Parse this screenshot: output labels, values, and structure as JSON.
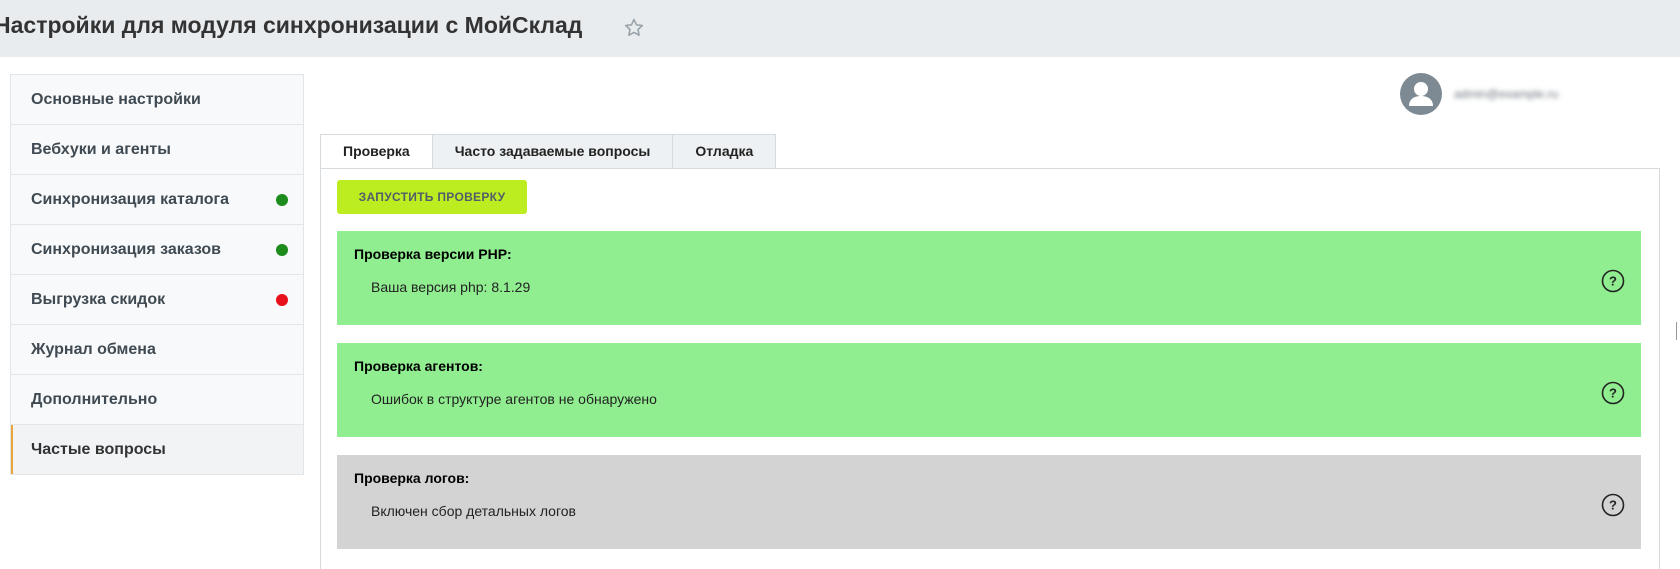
{
  "header": {
    "title": "Настройки для модуля синхронизации с МойСклад",
    "star_icon": "star-outline-icon"
  },
  "sidebar": {
    "items": [
      {
        "label": "Основные настройки",
        "status": null
      },
      {
        "label": "Вебхуки и агенты",
        "status": null
      },
      {
        "label": "Синхронизация каталога",
        "status": "green"
      },
      {
        "label": "Синхронизация заказов",
        "status": "green"
      },
      {
        "label": "Выгрузка скидок",
        "status": "red"
      },
      {
        "label": "Журнал обмена",
        "status": null
      },
      {
        "label": "Дополнительно",
        "status": null
      },
      {
        "label": "Частые вопросы",
        "status": null,
        "active": true
      }
    ]
  },
  "user": {
    "avatar_icon": "user-avatar-icon",
    "email": "admin@example.ru"
  },
  "tabs": [
    {
      "label": "Проверка",
      "active": true
    },
    {
      "label": "Часто задаваемые вопросы",
      "active": false
    },
    {
      "label": "Отладка",
      "active": false
    }
  ],
  "panel": {
    "run_button_label": "ЗАПУСТИТЬ ПРОВЕРКУ",
    "checks": [
      {
        "title": "Проверка версии PHP:",
        "text": "Ваша версия php: 8.1.29",
        "status": "success"
      },
      {
        "title": "Проверка агентов:",
        "text": "Ошибок в структуре агентов не обнаружено",
        "status": "success"
      },
      {
        "title": "Проверка логов:",
        "text": "Включен сбор детальных логов",
        "status": "neutral"
      }
    ],
    "help_icon": "question-circle-icon"
  },
  "colors": {
    "success_bg": "#90ee90",
    "neutral_bg": "#d3d3d3",
    "accent_button": "#bbed21",
    "dot_green": "#1c8c1c",
    "dot_red": "#e8101a",
    "active_border": "#e8a53a"
  }
}
